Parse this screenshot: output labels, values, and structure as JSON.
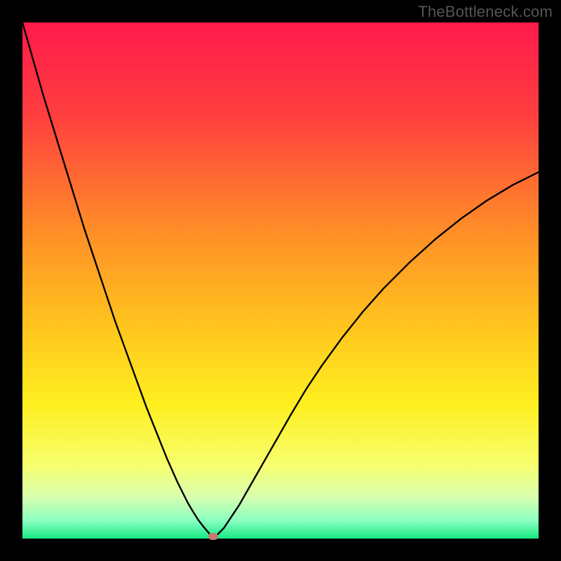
{
  "watermark": "TheBottleneck.com",
  "colors": {
    "black": "#000000",
    "curve": "#000000",
    "marker": "#c47b72",
    "gradient_stops": [
      {
        "offset": 0.0,
        "color": "#ff1a4b"
      },
      {
        "offset": 0.18,
        "color": "#ff3f3f"
      },
      {
        "offset": 0.4,
        "color": "#ff8c28"
      },
      {
        "offset": 0.58,
        "color": "#ffc21e"
      },
      {
        "offset": 0.74,
        "color": "#ffef20"
      },
      {
        "offset": 0.86,
        "color": "#f6ff70"
      },
      {
        "offset": 0.92,
        "color": "#d7ffb0"
      },
      {
        "offset": 0.965,
        "color": "#8affc0"
      },
      {
        "offset": 1.0,
        "color": "#17e884"
      }
    ]
  },
  "chart_data": {
    "type": "line",
    "title": "",
    "xlabel": "",
    "ylabel": "",
    "xlim": [
      0,
      100
    ],
    "ylim": [
      0,
      100
    ],
    "minimum": {
      "x": 37,
      "y": 0
    },
    "series": [
      {
        "name": "bottleneck-curve",
        "x": [
          0,
          2,
          4,
          6,
          8,
          10,
          12,
          14,
          16,
          18,
          20,
          22,
          24,
          26,
          28,
          30,
          32,
          33,
          34,
          35,
          36,
          37,
          38,
          39,
          40,
          41,
          42,
          44,
          46,
          48,
          50,
          52,
          55,
          58,
          62,
          66,
          70,
          75,
          80,
          85,
          90,
          95,
          100
        ],
        "values": [
          100,
          93,
          86,
          79.5,
          73,
          66.5,
          60,
          54,
          48,
          42,
          36.5,
          31,
          25.5,
          20.5,
          15.5,
          11,
          7,
          5.3,
          3.7,
          2.4,
          1.2,
          0,
          1,
          2,
          3.5,
          5,
          6.5,
          10,
          13.5,
          17,
          20.5,
          24,
          29,
          33.5,
          39,
          44,
          48.5,
          53.5,
          58,
          62,
          65.5,
          68.5,
          71
        ]
      }
    ]
  }
}
